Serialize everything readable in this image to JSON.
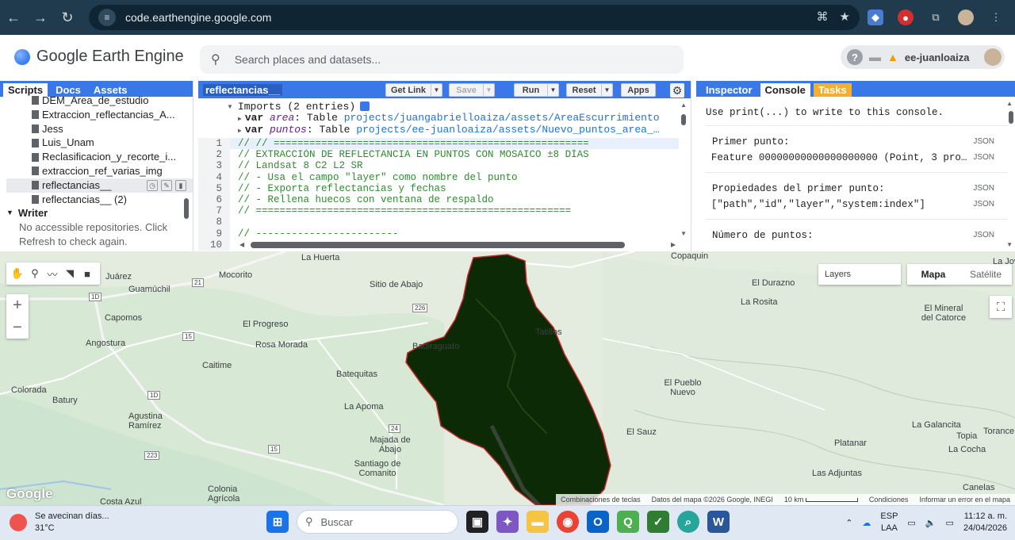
{
  "browser": {
    "url": "code.earthengine.google.com"
  },
  "header": {
    "app_title": "Google Earth Engine",
    "search_placeholder": "Search places and datasets...",
    "user": "ee-juanloaiza",
    "help_glyph": "?",
    "warning_glyph": "▲"
  },
  "left_panel": {
    "tabs": [
      "Scripts",
      "Docs",
      "Assets"
    ],
    "files": [
      "DEM_Area_de_estudio",
      "Extraccion_reflectancias_A...",
      "Jess",
      "Luis_Unam",
      "Reclasificacion_y_recorte_i...",
      "extraccion_ref_varias_img",
      "reflectancias__",
      "reflectancias__ (2)"
    ],
    "group": "Writer",
    "group_message_1": "No accessible repositories. Click",
    "group_message_2": "Refresh to check again."
  },
  "editor": {
    "file_name": "reflectancias__",
    "buttons": {
      "get_link": "Get Link",
      "save": "Save",
      "run": "Run",
      "reset": "Reset",
      "apps": "Apps"
    },
    "imports_header": "Imports (2 entries)",
    "imports": [
      {
        "kw": "var",
        "name": "area",
        "type": ": Table",
        "path": "projects/juangabrielloaiza/assets/AreaEscurrimiento"
      },
      {
        "kw": "var",
        "name": "puntos",
        "type": ": Table",
        "path": "projects/ee-juanloaiza/assets/Nuevo_puntos_area_…"
      }
    ],
    "lines": [
      {
        "n": "1",
        "t": "// // ====================================================="
      },
      {
        "n": "2",
        "t": "// EXTRACCIÓN DE REFLECTANCIA EN PUNTOS CON MOSAICO ±8 DÍAS"
      },
      {
        "n": "3",
        "t": "// Landsat 8 C2 L2 SR"
      },
      {
        "n": "4",
        "t": "// - Usa el campo \"layer\" como nombre del punto"
      },
      {
        "n": "5",
        "t": "// - Exporta reflectancias y fechas"
      },
      {
        "n": "6",
        "t": "// - Rellena huecos con ventana de respaldo"
      },
      {
        "n": "7",
        "t": "// ====================================================="
      },
      {
        "n": "8",
        "t": ""
      },
      {
        "n": "9",
        "t": "// ------------------------"
      },
      {
        "n": "10",
        "t": ""
      }
    ]
  },
  "right_panel": {
    "tabs": [
      "Inspector",
      "Console",
      "Tasks"
    ],
    "hint": "Use print(...) to write to this console.",
    "blocks": [
      {
        "title": "Primer punto:",
        "value": "Feature 00000000000000000000 (Point, 3 pro…"
      },
      {
        "title": "Propiedades del primer punto:",
        "value": "[\"path\",\"id\",\"layer\",\"system:index\"]"
      },
      {
        "title": "Número de puntos:",
        "value": ""
      }
    ],
    "json_tag": "JSON"
  },
  "map": {
    "layers_label": "Layers",
    "map_types": [
      "Mapa",
      "Satélite"
    ],
    "labels": [
      {
        "t": "La Huerta"
      },
      {
        "t": "Mocorito"
      },
      {
        "t": "Sitio de Abajo"
      },
      {
        "t": "Guamúchil"
      },
      {
        "t": "Capomos"
      },
      {
        "t": "El Progreso"
      },
      {
        "t": "Angostura"
      },
      {
        "t": "Rosa Morada"
      },
      {
        "t": "Caitime"
      },
      {
        "t": "Badiraguato"
      },
      {
        "t": "Batequitas"
      },
      {
        "t": "La Apoma"
      },
      {
        "t": "Majada de Abajo"
      },
      {
        "t": "Santiago de Comanito"
      },
      {
        "t": "Agustina Ramírez"
      },
      {
        "t": "Batury"
      },
      {
        "t": "Colonia Agrícola"
      },
      {
        "t": "Costa Azul"
      },
      {
        "t": "Copaquin"
      },
      {
        "t": "El Durazno"
      },
      {
        "t": "La Rosita"
      },
      {
        "t": "El Mineral del Catorce"
      },
      {
        "t": "El Pueblo Nuevo"
      },
      {
        "t": "El Sauz"
      },
      {
        "t": "Platanar"
      },
      {
        "t": "La Galancita"
      },
      {
        "t": "Topia"
      },
      {
        "t": "La Cocha"
      },
      {
        "t": "Las Adjuntas"
      },
      {
        "t": "Canelas"
      },
      {
        "t": "La Jova"
      },
      {
        "t": "Torance"
      },
      {
        "t": "Colorada"
      },
      {
        "t": "Juárez"
      },
      {
        "t": "Tatillos"
      }
    ],
    "road_numbers": [
      "21",
      "1D",
      "15",
      "226",
      "1D",
      "24",
      "15",
      "223"
    ],
    "attribution": [
      "Combinaciones de teclas",
      "Datos del mapa ©2026 Google, INEGI",
      "10 km",
      "Condiciones",
      "Informar un error en el mapa"
    ],
    "google": "Google"
  },
  "taskbar": {
    "weather_title": "Se avecinan días...",
    "weather_temp": "31°C",
    "search": "Buscar",
    "lang": "ESP",
    "lang2": "LAA",
    "time": "11:12 a. m.",
    "date": "24/04/2026"
  },
  "colors": {
    "ee_blue": "#3b78e7",
    "tasks_orange": "#f6ae2d",
    "basin_dark": "#0b2a05",
    "basin_outline": "#c62828"
  }
}
